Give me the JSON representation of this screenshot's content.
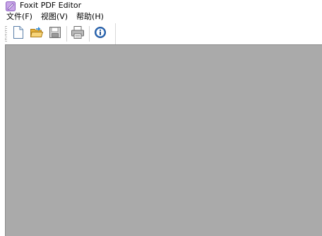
{
  "window": {
    "title": "Foxit PDF Editor",
    "app_icon": "foxit-app-icon"
  },
  "menubar": {
    "items": [
      {
        "label": "文件(F)"
      },
      {
        "label": "视图(V)"
      },
      {
        "label": "帮助(H)"
      }
    ]
  },
  "toolbar": {
    "buttons": [
      {
        "icon": "new-document-icon"
      },
      {
        "icon": "open-folder-icon"
      },
      {
        "icon": "save-disk-icon"
      },
      {
        "icon": "print-icon"
      },
      {
        "icon": "info-icon"
      }
    ]
  },
  "colors": {
    "workspace": "#aaaaaa",
    "open_folder_yellow": "#f2c14e",
    "info_blue": "#2f6fbf"
  }
}
